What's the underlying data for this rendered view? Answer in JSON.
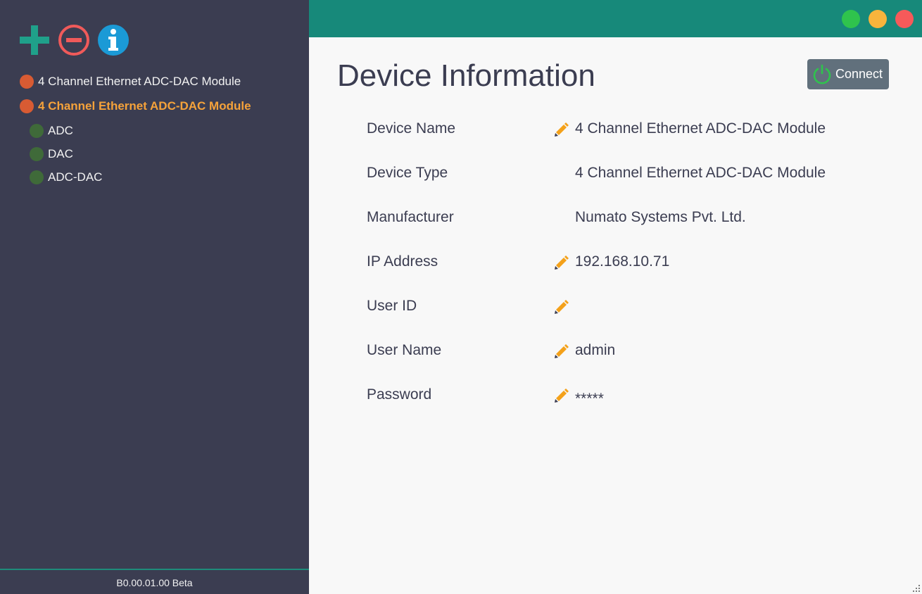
{
  "sidebar": {
    "toolbar": {
      "add_icon": "plus-icon",
      "remove_icon": "minus-circle-icon",
      "info_icon": "info-icon"
    },
    "devices": [
      {
        "label": "4 Channel Ethernet ADC-DAC Module",
        "status_color": "#d85b33",
        "selected": false
      },
      {
        "label": "4 Channel Ethernet ADC-DAC Module",
        "status_color": "#d85b33",
        "selected": true,
        "children": [
          {
            "label": "ADC"
          },
          {
            "label": "DAC"
          },
          {
            "label": "ADC-DAC"
          }
        ]
      }
    ],
    "version": "B0.00.01.00 Beta"
  },
  "header": {
    "window_buttons": [
      "#2fc34d",
      "#f8b43c",
      "#f65a5a"
    ],
    "accent": "#17897a"
  },
  "main": {
    "title": "Device Information",
    "connect_label": "Connect",
    "fields": [
      {
        "label": "Device Name",
        "value": "4 Channel Ethernet ADC-DAC Module",
        "editable": true
      },
      {
        "label": "Device Type",
        "value": "4 Channel Ethernet ADC-DAC Module",
        "editable": false
      },
      {
        "label": "Manufacturer",
        "value": "Numato Systems Pvt. Ltd.",
        "editable": false
      },
      {
        "label": "IP Address",
        "value": "192.168.10.71",
        "editable": true
      },
      {
        "label": "User ID",
        "value": "",
        "editable": true
      },
      {
        "label": "User Name",
        "value": "admin",
        "editable": true
      },
      {
        "label": "Password",
        "value": "*****",
        "editable": true
      }
    ]
  }
}
